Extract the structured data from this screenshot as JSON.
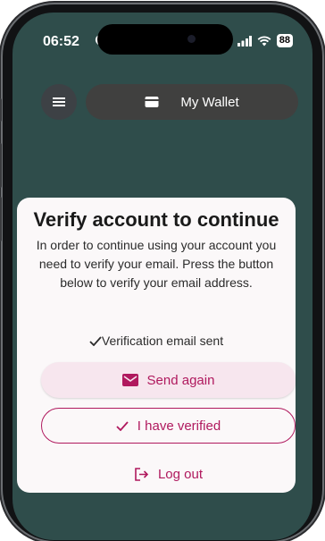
{
  "status_bar": {
    "time": "06:52",
    "battery": "88"
  },
  "app_bar": {
    "wallet_label": "My Wallet"
  },
  "dialog": {
    "title": "Verify account to continue",
    "message": "In order to continue using your account you need to verify your email. Press the button below to verify your email address.",
    "sent_status": "Verification email sent",
    "send_again_label": "Send again",
    "verified_label": "I have verified",
    "logout_label": "Log out"
  },
  "colors": {
    "accent": "#b0195e",
    "send_button_bg": "#f7e6ee",
    "dialog_bg": "#fbf8f9",
    "screen_bg": "#2f4d4b"
  },
  "icons": [
    "moon-icon",
    "signal-icon",
    "wifi-icon",
    "battery-icon",
    "menu-icon",
    "wallet-icon",
    "check-icon",
    "mail-icon",
    "logout-icon"
  ]
}
